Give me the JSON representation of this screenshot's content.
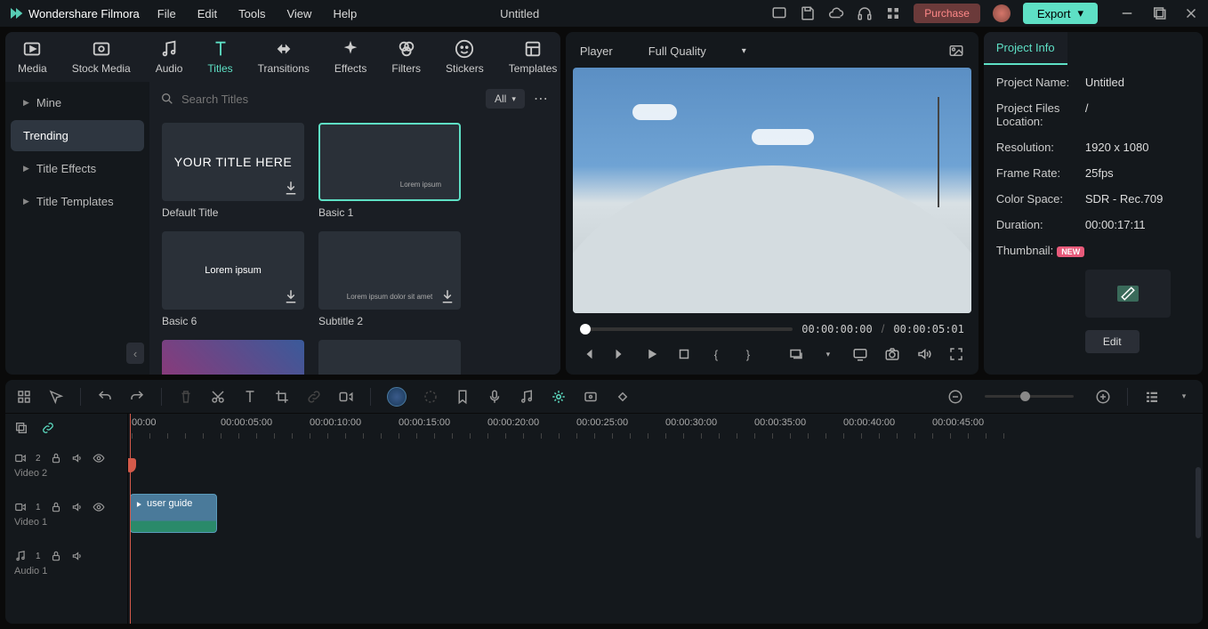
{
  "app": {
    "name": "Wondershare Filmora",
    "document": "Untitled"
  },
  "menu": [
    "File",
    "Edit",
    "Tools",
    "View",
    "Help"
  ],
  "titleButtons": {
    "purchase": "Purchase",
    "export": "Export"
  },
  "tabs": [
    {
      "id": "media",
      "label": "Media"
    },
    {
      "id": "stock",
      "label": "Stock Media"
    },
    {
      "id": "audio",
      "label": "Audio"
    },
    {
      "id": "titles",
      "label": "Titles",
      "active": true
    },
    {
      "id": "transitions",
      "label": "Transitions"
    },
    {
      "id": "effects",
      "label": "Effects"
    },
    {
      "id": "filters",
      "label": "Filters"
    },
    {
      "id": "stickers",
      "label": "Stickers"
    },
    {
      "id": "templates",
      "label": "Templates"
    }
  ],
  "sidebar": {
    "items": [
      {
        "label": "Mine"
      },
      {
        "label": "Trending",
        "selected": true
      },
      {
        "label": "Title Effects"
      },
      {
        "label": "Title Templates"
      }
    ]
  },
  "search": {
    "placeholder": "Search Titles"
  },
  "filter": {
    "label": "All"
  },
  "cards": [
    {
      "label": "Default Title",
      "thumbText": "YOUR TITLE HERE",
      "style": "big"
    },
    {
      "label": "Basic 1",
      "thumbText": "Lorem ipsum",
      "style": "small-br",
      "selected": true
    },
    {
      "label": "Basic 6",
      "thumbText": "Lorem ipsum",
      "style": "center"
    },
    {
      "label": "Subtitle 2",
      "thumbText": "Lorem ipsum dolor sit amet",
      "style": "small-bottom"
    }
  ],
  "player": {
    "label": "Player",
    "quality": "Full Quality",
    "current": "00:00:00:00",
    "duration": "00:00:05:01"
  },
  "projectInfo": {
    "tab": "Project Info",
    "rows": {
      "name": {
        "label": "Project Name:",
        "value": "Untitled"
      },
      "loc": {
        "label": "Project Files Location:",
        "value": "/"
      },
      "res": {
        "label": "Resolution:",
        "value": "1920 x 1080"
      },
      "fps": {
        "label": "Frame Rate:",
        "value": "25fps"
      },
      "cs": {
        "label": "Color Space:",
        "value": "SDR - Rec.709"
      },
      "dur": {
        "label": "Duration:",
        "value": "00:00:17:11"
      },
      "thumb": {
        "label": "Thumbnail:",
        "badge": "NEW"
      }
    },
    "edit": "Edit"
  },
  "timeline": {
    "marks": [
      "00:00",
      "00:00:05:00",
      "00:00:10:00",
      "00:00:15:00",
      "00:00:20:00",
      "00:00:25:00",
      "00:00:30:00",
      "00:00:35:00",
      "00:00:40:00",
      "00:00:45:00"
    ],
    "tracks": [
      {
        "id": "v2",
        "label": "Video 2",
        "type": "video",
        "num": "2"
      },
      {
        "id": "v1",
        "label": "Video 1",
        "type": "video",
        "num": "1"
      },
      {
        "id": "a1",
        "label": "Audio 1",
        "type": "audio",
        "num": "1"
      }
    ],
    "clip": {
      "label": "user guide"
    }
  }
}
